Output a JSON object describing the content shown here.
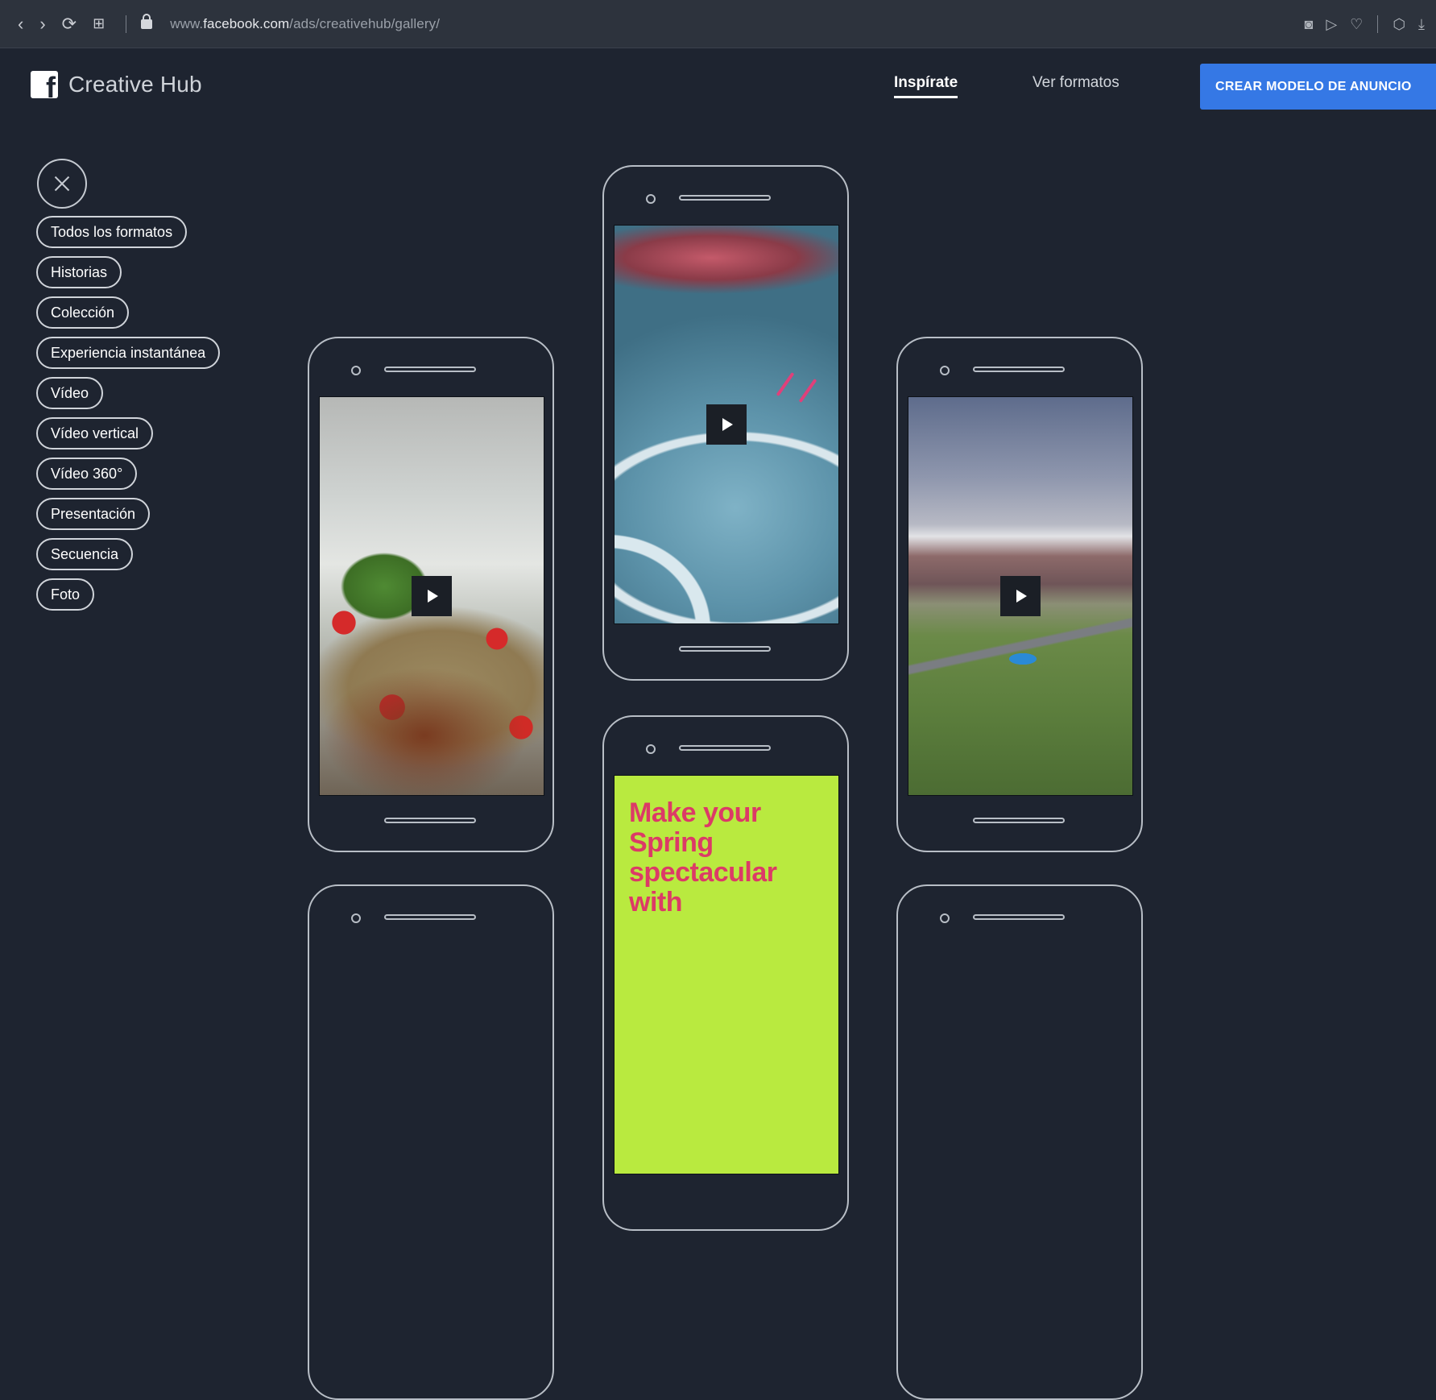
{
  "browser": {
    "url_prefix": "www.",
    "url_domain": "facebook.com",
    "url_path": "/ads/creativehub/gallery/"
  },
  "header": {
    "logo_text": "Creative Hub",
    "nav": [
      {
        "label": "Inspírate",
        "active": true
      },
      {
        "label": "Ver formatos",
        "active": false
      }
    ],
    "cta_label": "CREAR MODELO DE ANUNCIO"
  },
  "filters": {
    "items": [
      "Todos los formatos",
      "Historias",
      "Colección",
      "Experiencia instantánea",
      "Vídeo",
      "Vídeo vertical",
      "Vídeo 360°",
      "Presentación",
      "Secuencia",
      "Foto"
    ]
  },
  "gallery": {
    "spring_card_text": "Make your Spring spectacular with"
  },
  "colors": {
    "background": "#1e2430",
    "cta_blue": "#3578e5",
    "lime_card": "#b9ea3f",
    "pink_text": "#dc3a67"
  }
}
